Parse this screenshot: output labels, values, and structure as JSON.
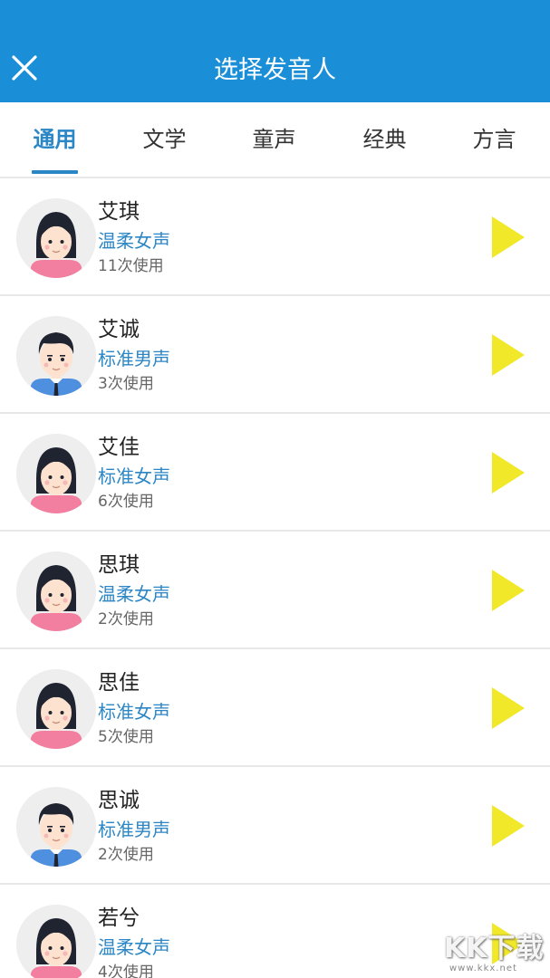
{
  "header": {
    "title": "选择发音人",
    "background": "#1a8fd8"
  },
  "tabs": [
    {
      "label": "通用",
      "active": true
    },
    {
      "label": "文学",
      "active": false
    },
    {
      "label": "童声",
      "active": false
    },
    {
      "label": "经典",
      "active": false
    },
    {
      "label": "方言",
      "active": false
    }
  ],
  "speakers": [
    {
      "name": "艾琪",
      "type": "温柔女声",
      "usage": "11次使用",
      "avatar": "female"
    },
    {
      "name": "艾诚",
      "type": "标准男声",
      "usage": "3次使用",
      "avatar": "male"
    },
    {
      "name": "艾佳",
      "type": "标准女声",
      "usage": "6次使用",
      "avatar": "female"
    },
    {
      "name": "思琪",
      "type": "温柔女声",
      "usage": "2次使用",
      "avatar": "female"
    },
    {
      "name": "思佳",
      "type": "标准女声",
      "usage": "5次使用",
      "avatar": "female"
    },
    {
      "name": "思诚",
      "type": "标准男声",
      "usage": "2次使用",
      "avatar": "male"
    },
    {
      "name": "若兮",
      "type": "温柔女声",
      "usage": "4次使用",
      "avatar": "female"
    }
  ],
  "icons": {
    "close": "close-icon",
    "play": "play-icon",
    "avatar_female": "female-avatar-icon",
    "avatar_male": "male-avatar-icon"
  },
  "colors": {
    "accent": "#2b86c5",
    "play": "#f2e82a",
    "female_shirt": "#f27ea0",
    "male_shirt": "#4f8fe0"
  },
  "watermark": {
    "logo": "KK下载",
    "url": "www.kkx.net"
  }
}
